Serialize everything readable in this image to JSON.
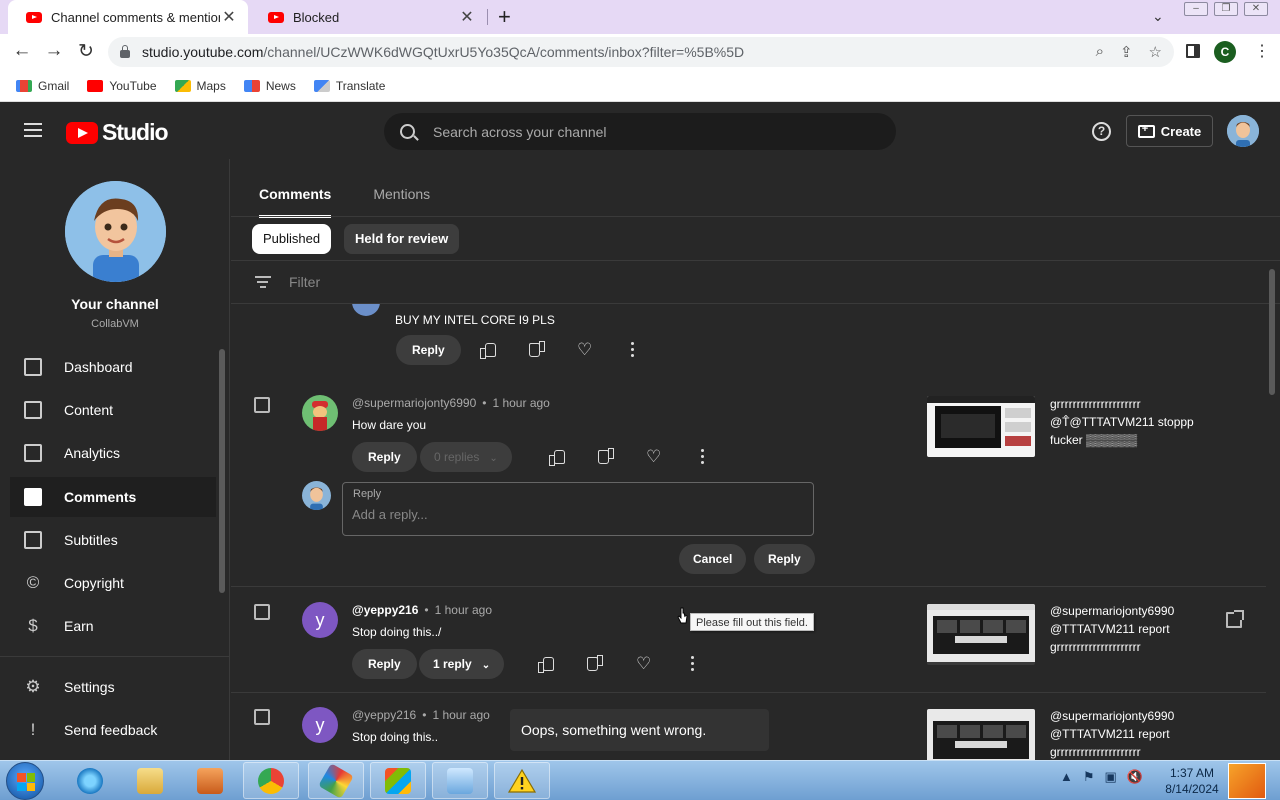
{
  "browser": {
    "tabs": [
      {
        "title": "Channel comments & mentions",
        "active": true
      },
      {
        "title": "Blocked",
        "active": false
      }
    ],
    "url_host": "studio.youtube.com",
    "url_path": "/channel/UCzWWK6dWGQtUxrU5Yo35QcA/comments/inbox?filter=%5B%5D",
    "profile_initial": "C",
    "bookmarks": [
      "Gmail",
      "YouTube",
      "Maps",
      "News",
      "Translate"
    ]
  },
  "studio": {
    "logo_text": "Studio",
    "search_placeholder": "Search across your channel",
    "create_label": "Create",
    "help_glyph": "?"
  },
  "sidebar": {
    "channel_title": "Your channel",
    "channel_handle": "CollabVM",
    "items": [
      {
        "label": "Dashboard",
        "icon": "dashboard-icon"
      },
      {
        "label": "Content",
        "icon": "content-icon"
      },
      {
        "label": "Analytics",
        "icon": "analytics-icon"
      },
      {
        "label": "Comments",
        "icon": "comments-icon",
        "active": true
      },
      {
        "label": "Subtitles",
        "icon": "subtitles-icon"
      },
      {
        "label": "Copyright",
        "icon": "copyright-icon"
      },
      {
        "label": "Earn",
        "icon": "earn-icon"
      }
    ],
    "settings_label": "Settings",
    "feedback_label": "Send feedback"
  },
  "main": {
    "tabs": [
      "Comments",
      "Mentions"
    ],
    "chips": [
      "Published",
      "Held for review"
    ],
    "filter_placeholder": "Filter",
    "comments": [
      {
        "author": "",
        "time": "",
        "text": "BUY MY INTEL CORE I9 PLS",
        "reply_label": "Reply"
      },
      {
        "author": "@supermariojonty6990",
        "time": "1 hour ago",
        "text": "How dare you",
        "reply_label": "Reply",
        "replies_label": "0 replies",
        "video_title_lines": [
          "grrrrrrrrrrrrrrrrrrrrr",
          "@T̂@TTTATVM211  stoppp",
          "fucker ▒▒▒▒▒▒"
        ]
      },
      {
        "author": "@yeppy216",
        "time": "1 hour ago",
        "text": "Stop doing this../",
        "reply_label": "Reply",
        "replies_label": "1 reply",
        "avatar_letter": "y",
        "video_title_lines": [
          "@supermariojonty6990",
          "@TTTATVM211  report",
          "grrrrrrrrrrrrrrrrrrrrr"
        ]
      },
      {
        "author": "@yeppy216",
        "time": "1 hour ago",
        "text": "Stop doing this..",
        "avatar_letter": "y",
        "video_title_lines": [
          "@supermariojonty6990",
          "@TTTATVM211  report",
          "grrrrrrrrrrrrrrrrrrrrr"
        ]
      }
    ],
    "reply_box": {
      "label": "Reply",
      "placeholder": "Add a reply...",
      "cancel_label": "Cancel",
      "submit_label": "Reply"
    },
    "tooltip": "Please fill out this field.",
    "snackbar": "Oops, something went wrong."
  },
  "taskbar": {
    "time": "1:37 AM",
    "date": "8/14/2024"
  },
  "colors": {
    "youtube_red": "#ff0000",
    "studio_bg": "#282828",
    "tabstrip_bg": "#e6d9f5",
    "letter_avatar": "#7e57c2"
  }
}
